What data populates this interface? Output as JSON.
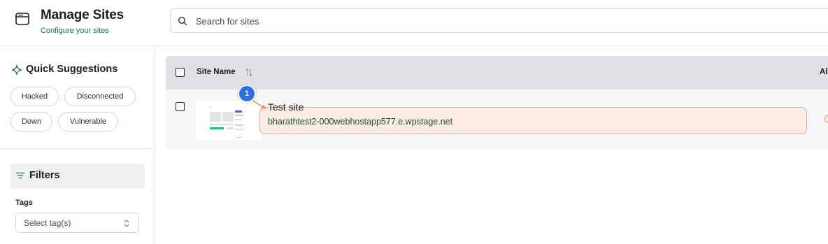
{
  "header": {
    "title": "Manage Sites",
    "subtitle": "Configure your sites",
    "icon": "browser-window-icon"
  },
  "search": {
    "placeholder": "Search for sites",
    "value": ""
  },
  "sidebar": {
    "quick_suggestions": {
      "title": "Quick Suggestions",
      "icon": "sparkle-icon",
      "chips": [
        "Hacked",
        "Disconnected",
        "Down",
        "Vulnerable"
      ]
    },
    "filters": {
      "title": "Filters",
      "icon": "filter-icon",
      "tags_label": "Tags",
      "tags_select_placeholder": "Select tag(s)"
    }
  },
  "table": {
    "columns": [
      "Site Name",
      "Al"
    ],
    "rows": [
      {
        "name": "Test site",
        "url": "bharathtest2-000webhostapp577.e.wpstage.net"
      }
    ]
  },
  "annotation": {
    "step_number": "1"
  },
  "colors": {
    "accent_green": "#137a3e",
    "highlight_fill": "#fdece3",
    "highlight_border": "#f2a781",
    "badge_blue": "#2f6fe4"
  }
}
